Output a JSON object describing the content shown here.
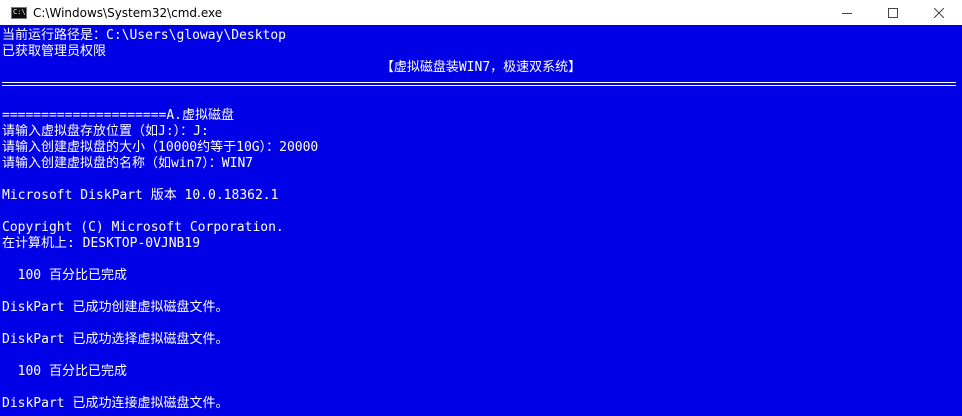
{
  "window": {
    "title": "C:\\Windows\\System32\\cmd.exe",
    "icon": "cmd-icon",
    "icon_prompt": "C:\\",
    "controls": [
      "minimize-icon",
      "maximize-icon",
      "close-icon"
    ],
    "console_background": "#0000e6",
    "console_foreground": "#ffffff"
  },
  "console": {
    "line_1": "当前运行路径是：C:\\Users\\gloway\\Desktop",
    "line_2": "已获取管理员权限",
    "banner": "【虚拟磁盘装WIN7，极速双系统】",
    "section_header": "=====================A.虚拟磁盘",
    "prompt_location": "请输入虚拟盘存放位置（如J:）：J:",
    "prompt_size": "请输入创建虚拟盘的大小（10000约等于10G）：20000",
    "prompt_name": "请输入创建虚拟盘的名称（如win7）：WIN7",
    "diskpart_version": "Microsoft DiskPart 版本 10.0.18362.1",
    "copyright": "Copyright (C) Microsoft Corporation.",
    "computer": "在计算机上: DESKTOP-0VJNB19",
    "progress_1": "  100 百分比已完成",
    "created": "DiskPart 已成功创建虚拟磁盘文件。",
    "selected": "DiskPart 已成功选择虚拟磁盘文件。",
    "progress_2": "  100 百分比已完成",
    "attached": "DiskPart 已成功连接虚拟磁盘文件。"
  }
}
